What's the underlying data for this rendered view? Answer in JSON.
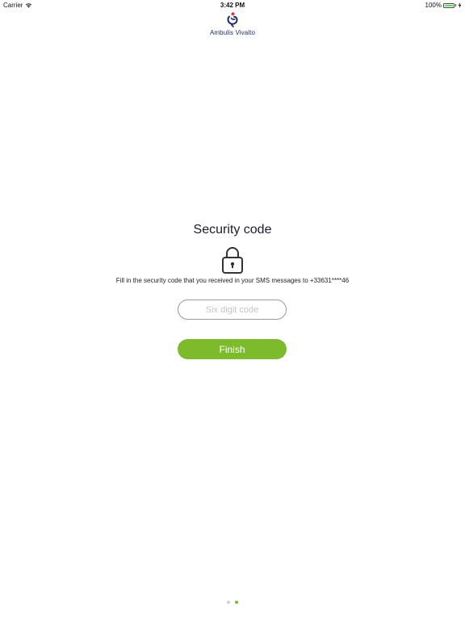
{
  "status_bar": {
    "carrier": "Carrier",
    "time": "3:42 PM",
    "battery": "100%",
    "battery_level": 1.0,
    "icons": [
      "wifi-icon",
      "battery-icon",
      "charging-icon"
    ]
  },
  "header": {
    "logo_text": "Ambulis Vivalto",
    "logo_icon": "ambulis-logo"
  },
  "security": {
    "title": "Security code",
    "icon": "lock-icon",
    "instructions": "Fill in the security code that you received in your SMS messages to +33631****46",
    "code_input": {
      "placeholder": "Six digit code",
      "value": ""
    },
    "finish_label": "Finish"
  },
  "pagination": {
    "total": 2,
    "current": 2
  },
  "colors": {
    "accent": "#7dbb2d",
    "brand_navy": "#1f2a5e",
    "brand_red": "#e0343c",
    "input_border": "#9a9a9a",
    "placeholder": "#c4c4c4",
    "dot_inactive": "#d0d0d0"
  }
}
